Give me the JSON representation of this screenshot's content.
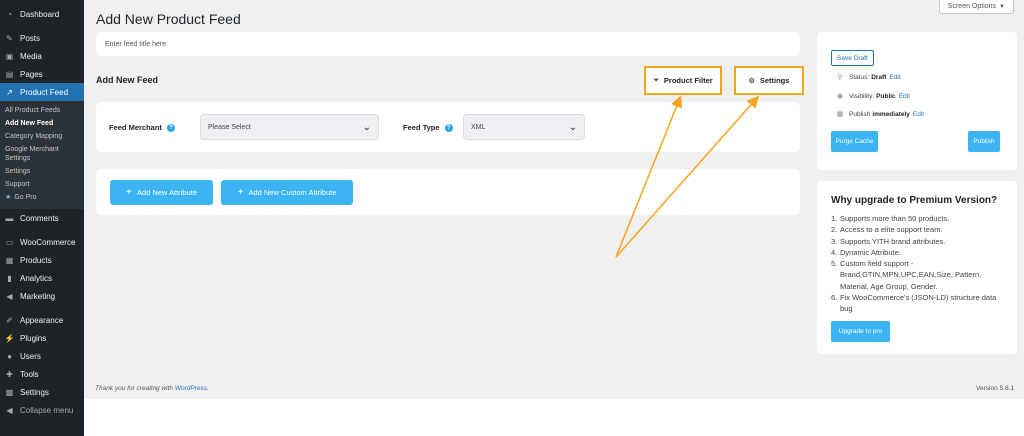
{
  "sidebar": {
    "top_items": [
      {
        "label": "Dashboard",
        "icon": "dashboard-icon"
      },
      {
        "label": "Posts",
        "icon": "pin-icon"
      },
      {
        "label": "Media",
        "icon": "media-icon"
      },
      {
        "label": "Pages",
        "icon": "pages-icon"
      }
    ],
    "active_item": {
      "label": "Product Feed",
      "icon": "chart-line-icon"
    },
    "submenu": [
      "All Product Feeds",
      "Add New Feed",
      "Category Mapping",
      "Google Merchant Settings",
      "Settings",
      "Support"
    ],
    "go_pro": "Go Pro",
    "comments": "Comments",
    "commerce_items": [
      "WooCommerce",
      "Products",
      "Analytics",
      "Marketing"
    ],
    "admin_items": [
      "Appearance",
      "Plugins",
      "Users",
      "Tools",
      "Settings"
    ],
    "collapse": "Collapse menu"
  },
  "header": {
    "title": "Add New Product Feed",
    "screen_options": "Screen Options"
  },
  "feed_title": {
    "placeholder": "Enter feed title here"
  },
  "section": {
    "heading": "Add New Feed",
    "product_filter": "Product Filter",
    "settings": "Settings"
  },
  "merchant": {
    "merchant_label": "Feed Merchant",
    "merchant_value": "Please Select",
    "type_label": "Feed Type",
    "type_value": "XML"
  },
  "attributes": {
    "add_attribute": "Add New Attribute",
    "add_custom_attribute": "Add New Custom Attribute"
  },
  "publish": {
    "save_draft": "Save Draft",
    "status_label": "Status:",
    "status_value": "Draft",
    "visibility_label": "Visibility:",
    "visibility_value": "Public",
    "publish_label": "Publish",
    "publish_value": "immediately",
    "edit": "Edit",
    "purge_cache": "Purge Cache",
    "publish_button": "Publish"
  },
  "premium": {
    "title": "Why upgrade to Premium Version?",
    "items": [
      "Supports more than 50 products.",
      "Access to a elite support team.",
      "Supports YITH brand attributes.",
      "Dynamic Attribute.",
      "Custom field support - Brand,GTIN,MPN,UPC,EAN,Size, Pattern, Material, Age Group, Gender.",
      "Fix WooCommerce's (JSON-LD) structure data bug"
    ],
    "upgrade_button": "Upgrade to pro"
  },
  "footer": {
    "thanks_prefix": "Thank you for creating with",
    "thanks_link": "WordPress",
    "thanks_suffix": ".",
    "version": "Version 5.8.1"
  },
  "colors": {
    "sidebar_bg": "#1d2327",
    "active_blue": "#2271b1",
    "button_blue": "#3cb4f2",
    "highlight_orange": "#f7a41d",
    "page_bg": "#f0f0f1"
  }
}
